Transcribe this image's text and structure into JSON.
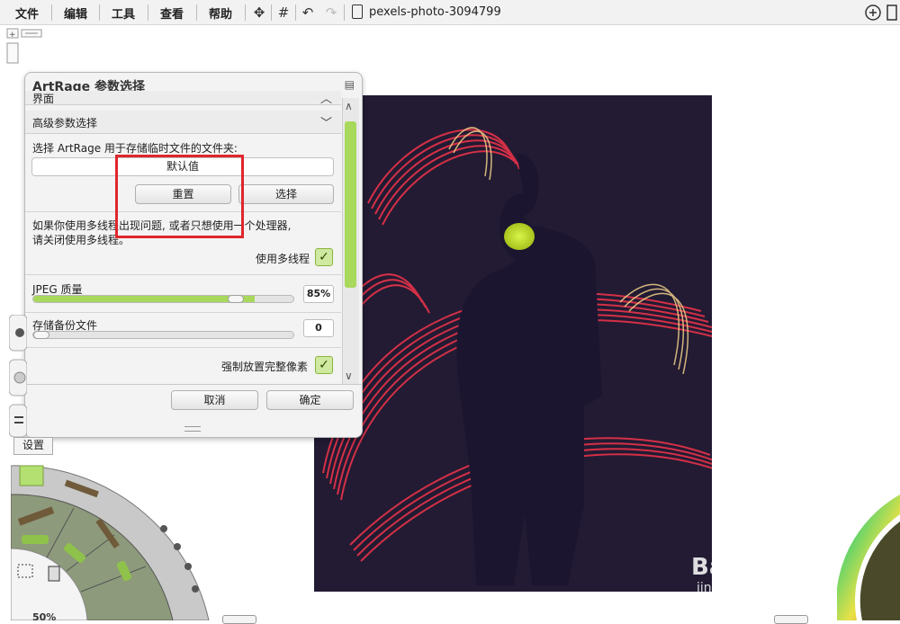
{
  "menu": {
    "file": "文件",
    "edit": "编辑",
    "tools": "工具",
    "view": "查看",
    "help": "帮助"
  },
  "document": {
    "title": "pexels-photo-3094799"
  },
  "panel": {
    "title": "ArtRage 参数选择",
    "section_interface": "界面",
    "section_advanced": "高级参数选择",
    "temp_folder_label": "选择 ArtRage 用于存储临时文件的文件夹:",
    "temp_folder_value": "默认值",
    "reset_label": "重置",
    "choose_label": "选择",
    "multithread_note_1": "如果你使用多线程出现问题, 或者只想使用一个处理器,",
    "multithread_note_2": "请关闭使用多线程。",
    "use_multithread_label": "使用多线程",
    "use_multithread_checked": true,
    "jpeg_label": "JPEG 质量",
    "jpeg_value": "85%",
    "jpeg_fraction": 0.85,
    "backup_label": "存储备份文件",
    "backup_value": "0",
    "force_pixels_label": "强制放置完整像素",
    "force_pixels_checked": true,
    "cancel_label": "取消",
    "ok_label": "确定"
  },
  "side": {
    "settings_label": "设置",
    "zoom_label": "50%"
  },
  "watermark": {
    "brand": "Baidu经验",
    "url": "jingyan.baidu.com"
  },
  "colors": {
    "accent": "#a8d85c",
    "highlight": "#e0262d",
    "photo_bg": "#221b33"
  }
}
